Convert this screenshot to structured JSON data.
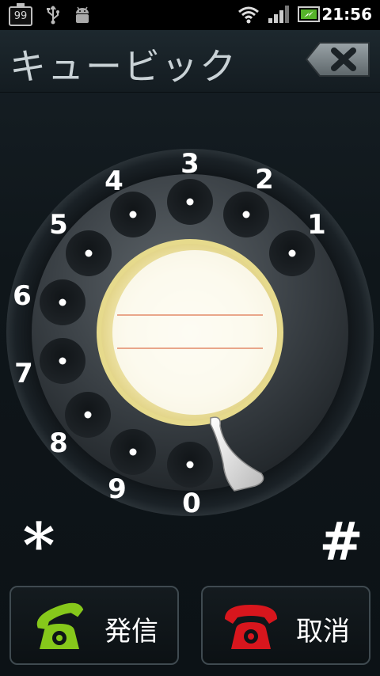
{
  "status_bar": {
    "battery_level": "99",
    "time": "21:56",
    "icons": [
      "battery-icon",
      "usb-icon",
      "android-debug-icon",
      "wifi-icon",
      "signal-icon",
      "charging-battery-icon"
    ]
  },
  "header": {
    "title": "キュービック",
    "backspace_icon": "backspace-icon"
  },
  "dial": {
    "digits": [
      "1",
      "2",
      "3",
      "4",
      "5",
      "6",
      "7",
      "8",
      "9",
      "0"
    ],
    "star_label": "*",
    "hash_label": "#"
  },
  "buttons": {
    "call_label": "発信",
    "cancel_label": "取消",
    "call_icon": "green-phone-icon",
    "cancel_icon": "red-phone-icon"
  },
  "colors": {
    "call_green": "#86c81b",
    "cancel_red": "#d8161d",
    "dial_center": "#f7f1c2"
  }
}
